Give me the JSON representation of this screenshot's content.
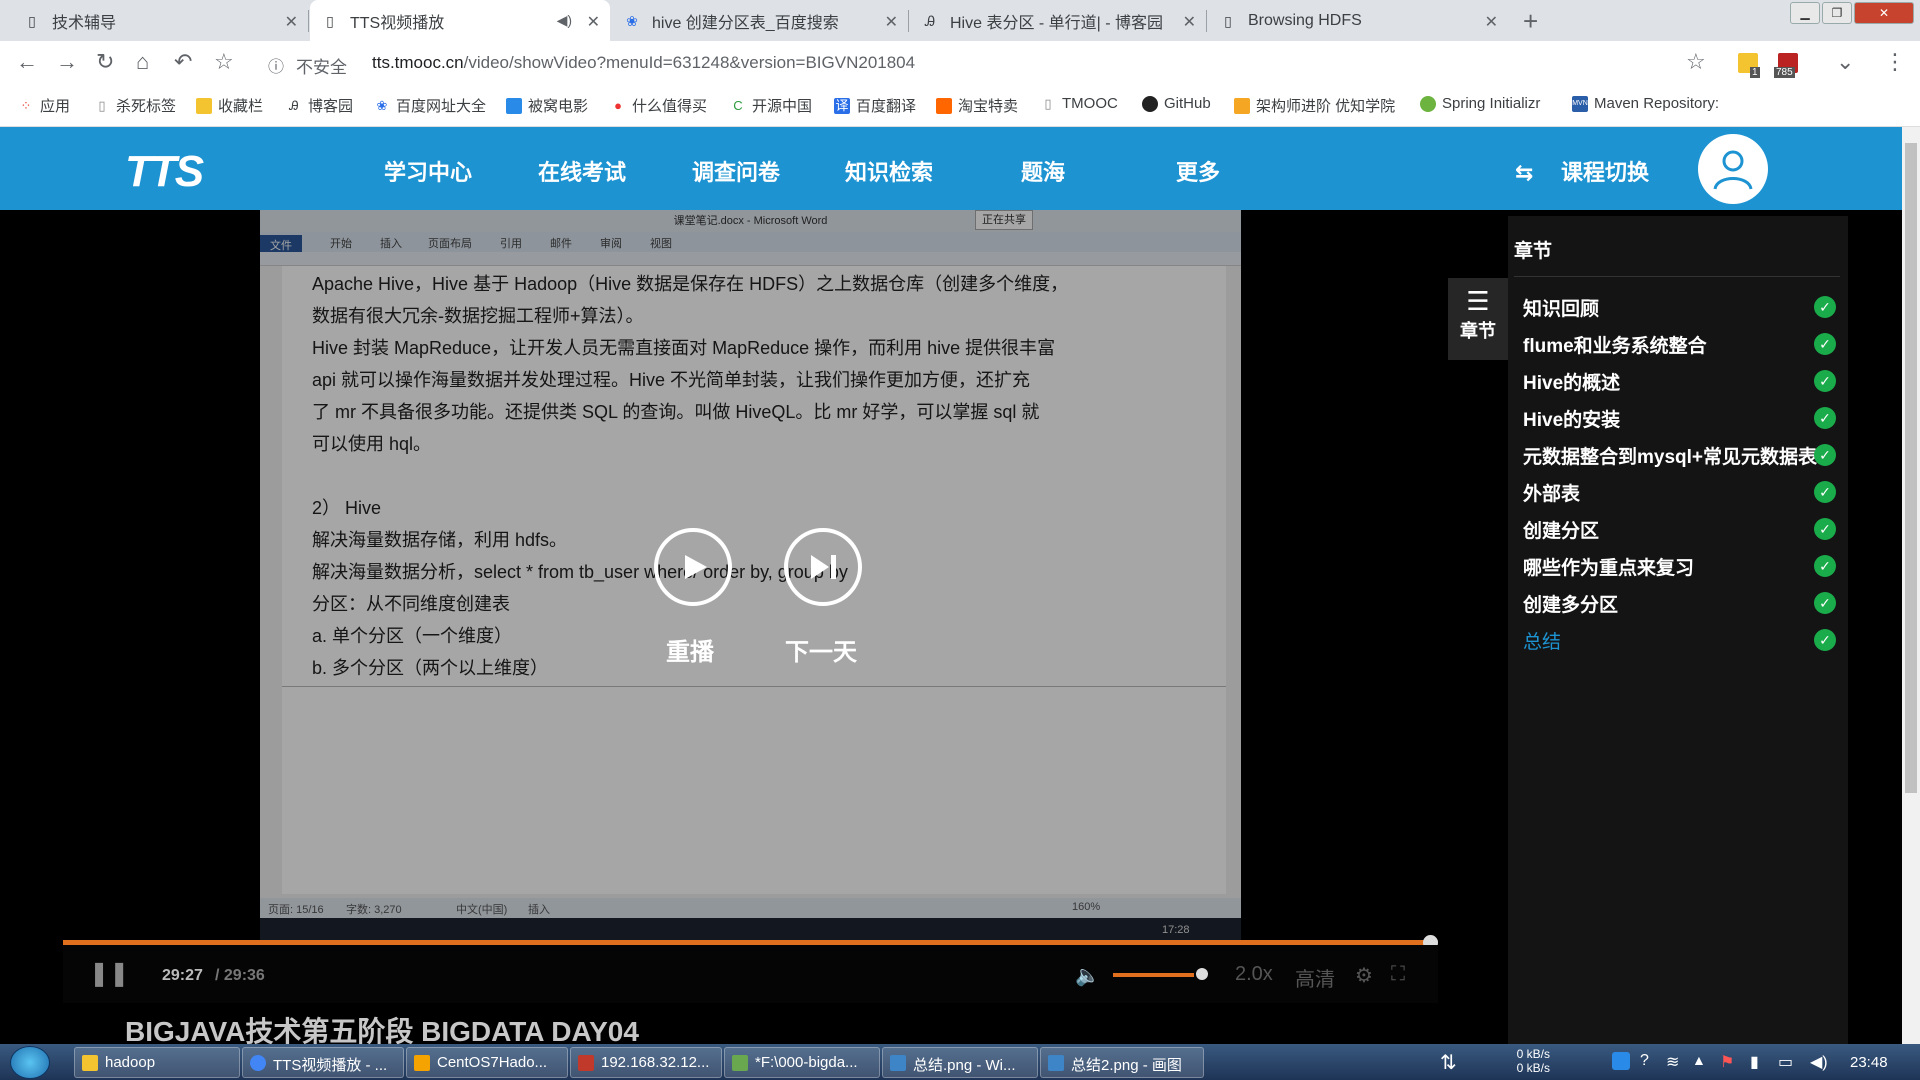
{
  "browser": {
    "tabs": [
      {
        "title": "技术辅导",
        "active": false
      },
      {
        "title": "TTS视频播放",
        "active": true
      },
      {
        "title": "hive 创建分区表_百度搜索",
        "active": false
      },
      {
        "title": "Hive 表分区 - 单行道| - 博客园",
        "active": false
      },
      {
        "title": "Browsing HDFS",
        "active": false
      }
    ],
    "not_secure": "不安全",
    "url_host": "tts.tmooc.cn",
    "url_path": "/video/showVideo?menuId=631248&version=BIGVN201804",
    "extension_badge": "785",
    "extension_badge2": "1",
    "bookmarks": [
      {
        "label": "应用",
        "icon": "apps-icon",
        "color": "#e94235"
      },
      {
        "label": "杀死标签",
        "icon": "page-icon",
        "color": "#888888"
      },
      {
        "label": "收藏栏",
        "icon": "folder-icon",
        "color": "#f4c430"
      },
      {
        "label": "博客园",
        "icon": "cnblogs-icon",
        "color": "#555555"
      },
      {
        "label": "百度网址大全",
        "icon": "baidu-icon",
        "color": "#2a6ee8"
      },
      {
        "label": "被窝电影",
        "icon": "movie-icon",
        "color": "#2a8ae8"
      },
      {
        "label": "什么值得买",
        "icon": "smzdm-icon",
        "color": "#e33"
      },
      {
        "label": "开源中国",
        "icon": "oschina-icon",
        "color": "#2c9a3c"
      },
      {
        "label": "百度翻译",
        "icon": "translate-icon",
        "color": "#2a6ee8"
      },
      {
        "label": "淘宝特卖",
        "icon": "taobao-icon",
        "color": "#f60"
      },
      {
        "label": "TMOOC",
        "icon": "page-icon",
        "color": "#888888"
      },
      {
        "label": "GitHub",
        "icon": "github-icon",
        "color": "#222222"
      },
      {
        "label": "架构师进阶 优知学院",
        "icon": "youzhi-icon",
        "color": "#f5a623"
      },
      {
        "label": "Spring Initializr",
        "icon": "spring-icon",
        "color": "#6db33f"
      },
      {
        "label": "Maven Repository:",
        "icon": "maven-icon",
        "color": "#2a5ea8"
      }
    ]
  },
  "site": {
    "logo": "TTS",
    "nav": [
      "学习中心",
      "在线考试",
      "调查问卷",
      "知识检索",
      "题海",
      "更多"
    ],
    "course_switch": "课程切换"
  },
  "word": {
    "title": "课堂笔记.docx - Microsoft Word",
    "sharing": "正在共享",
    "ribbon_tabs": [
      "文件",
      "开始",
      "插入",
      "页面布局",
      "引用",
      "邮件",
      "审阅",
      "视图"
    ],
    "lines": [
      "Apache Hive，Hive 基于 Hadoop（Hive 数据是保存在 HDFS）之上数据仓库（创建多个维度，",
      "数据有很大冗余-数据挖掘工程师+算法）。",
      "Hive 封装 MapReduce，让开发人员无需直接面对 MapReduce 操作，而利用 hive 提供很丰富",
      "api 就可以操作海量数据并发处理过程。Hive 不光简单封装，让我们操作更加方便，还扩充",
      "了 mr 不具备很多功能。还提供类 SQL 的查询。叫做 HiveQL。比 mr 好学，可以掌握 sql 就",
      "可以使用 hql。",
      "",
      "2） Hive",
      "解决海量数据存储，利用 hdfs。",
      "解决海量数据分析，select * from tb_user where/ order by, group by",
      "分区：从不同维度创建表",
      "a.   单个分区（一个维度）",
      "b.   多个分区（两个以上维度）"
    ],
    "status_page": "页面: 15/16",
    "status_words": "字数: 3,270",
    "status_lang": "中文(中国)",
    "status_mode": "插入",
    "status_zoom": "160%",
    "inner_clock": "17:28"
  },
  "player": {
    "replay_label": "重播",
    "next_label": "下一天",
    "current_time": "29:27",
    "total_time": "/ 29:36",
    "progress": 0.995,
    "volume": 0.85,
    "speed": "2.0x",
    "quality": "高清",
    "course_title": "BIGJAVA技术第五阶段 BIGDATA DAY04",
    "accent_color": "#e0701e"
  },
  "sidebar": {
    "heading": "章节",
    "toggle_label": "章节",
    "chapters": [
      {
        "title": "知识回顾",
        "done": true,
        "current": false
      },
      {
        "title": "flume和业务系统整合",
        "done": true,
        "current": false
      },
      {
        "title": "Hive的概述",
        "done": true,
        "current": false
      },
      {
        "title": "Hive的安装",
        "done": true,
        "current": false
      },
      {
        "title": "元数据整合到mysql+常见元数据表",
        "done": true,
        "current": false
      },
      {
        "title": "外部表",
        "done": true,
        "current": false
      },
      {
        "title": "创建分区",
        "done": true,
        "current": false
      },
      {
        "title": "哪些作为重点来复习",
        "done": true,
        "current": false
      },
      {
        "title": "创建多分区",
        "done": true,
        "current": false
      },
      {
        "title": "总结",
        "done": true,
        "current": true
      }
    ]
  },
  "taskbar": {
    "items": [
      {
        "label": "hadoop",
        "color": "#f4c430"
      },
      {
        "label": "TTS视频播放 - ...",
        "color": "#4285f4"
      },
      {
        "label": "CentOS7Hado...",
        "color": "#f4a300"
      },
      {
        "label": "192.168.32.12...",
        "color": "#c0392b"
      },
      {
        "label": "*F:\\000-bigda...",
        "color": "#6aa84f"
      },
      {
        "label": "总结.png - Wi...",
        "color": "#3d85c6"
      },
      {
        "label": "总结2.png - 画图",
        "color": "#3d85c6"
      }
    ],
    "net_up": "0 kB/s",
    "net_down": "0 kB/s",
    "clock": "23:48"
  }
}
